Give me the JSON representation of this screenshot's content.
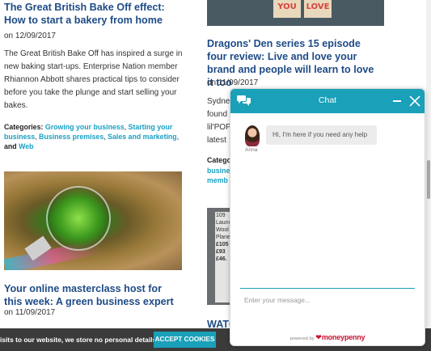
{
  "left_column": {
    "post1": {
      "title": "The Great British Bake Off effect: How to start a bakery from home",
      "date": "on 12/09/2017",
      "excerpt": "The Great British Bake Off has inspired a surge in new baking start-ups. Enterprise Nation member Rhiannon Abbott shares practical tips to consider before you take the plunge and start selling your bakes.",
      "categories_label": "Categories:",
      "categories": [
        "Growing your business",
        "Starting your business",
        "Business premises",
        "Sales and marketing",
        "Web"
      ],
      "and_word": "and"
    },
    "post2": {
      "title": "Your online masterclass host for this week: A green business expert",
      "date": "on 11/09/2017"
    }
  },
  "right_column": {
    "image_blocks": [
      "YOU",
      "LOVE"
    ],
    "post1": {
      "title": "Dragons' Den series 15 episode four review: Live and love your brand and people will learn to love it too",
      "date": "on 11/09/2017",
      "excerpt_partial": [
        "Sydne",
        "found",
        "lil'POP",
        "latest"
      ],
      "categories_partial": [
        "Catego",
        "busine",
        "memb"
      ]
    },
    "image_text": [
      "109",
      "Launc",
      "Wool",
      "Plane",
      "£105",
      "£93",
      "£46."
    ],
    "post2_partial_title": "WATC"
  },
  "cookie": {
    "text": "isits to our website, we store no personal details.",
    "button": "ACCEPT COOKIES"
  },
  "chat": {
    "title": "Chat",
    "agent_name": "Anna",
    "message": "Hi, I'm here if you need any help",
    "input_placeholder": "Enter your message...",
    "powered_by": "powered by",
    "brand": "moneypenny"
  },
  "colors": {
    "link_blue": "#1e4b86",
    "accent_teal": "#1aa0b8",
    "cookie_bar": "#3b3b3b"
  }
}
